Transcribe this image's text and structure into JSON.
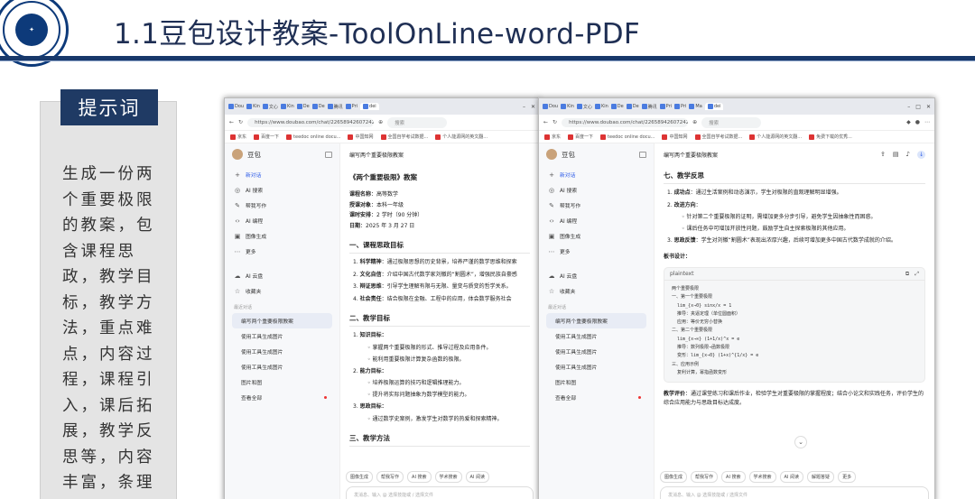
{
  "slide": {
    "title": "1.1豆包设计教案-ToolOnLine-word-PDF",
    "colors": {
      "navy": "#17386a",
      "badge": "#1f3a64",
      "panel": "#e4e4e4",
      "accent": "#2c5be8"
    },
    "logo_icon": "university-seal-icon"
  },
  "prompt": {
    "badge": "提示词",
    "text": "生成一份两个重要极限的教案，包含课程思政，教学目标，教学方法，重点难点，内容过程，课程引入，课后拓展，教学反思等，内容丰富，条理清晰。"
  },
  "browser": {
    "tabs": [
      "Dou",
      "Kin",
      "文心",
      "Kin",
      "De",
      "De",
      "腾讯",
      "Pri",
      "Pri",
      "Ma",
      "dei"
    ],
    "url": "https://www.doubao.com/chat/2265894260724226",
    "search_placeholder": "搜索",
    "bookmarks": [
      "京东",
      "百度一下",
      "teedoc online docu...",
      "中国知网",
      "全国自学考试数据...",
      "个人能源网的英文翻...",
      "免费下载的优秀..."
    ]
  },
  "app": {
    "name": "豆包",
    "nav": [
      {
        "label": "新对话",
        "icon": "+"
      },
      {
        "label": "AI 搜索",
        "icon": "◎"
      },
      {
        "label": "帮我写作",
        "icon": "✎"
      },
      {
        "label": "AI 编程",
        "icon": "‹›"
      },
      {
        "label": "图像生成",
        "icon": "▣"
      },
      {
        "label": "更多",
        "icon": "⋯"
      }
    ],
    "nav2": [
      {
        "label": "AI 云盘",
        "icon": "☁"
      },
      {
        "label": "收藏夹",
        "icon": "☆"
      }
    ],
    "history_header": "最近对话",
    "history": [
      "编写两个重要极限教案",
      "使用工具生成图片",
      "使用工具生成图片",
      "使用工具生成图片",
      "图片和图",
      "查看全部"
    ],
    "chat_title": "编写两个重要极限教案",
    "chips": [
      "图像生成",
      "帮我写作",
      "AI 搜索",
      "学术搜索",
      "AI 阅读"
    ],
    "chips2": [
      "图像生成",
      "帮我写作",
      "AI 搜索",
      "学术搜索",
      "AI 阅读",
      "解题答疑",
      "更多"
    ],
    "input_placeholder": "发消息、输入 @ 选择技能或 / 选择文件"
  },
  "doc1": {
    "title": "《两个重要极限》教案",
    "info": [
      {
        "k": "课程名称",
        "v": "高等数学"
      },
      {
        "k": "授课对象",
        "v": "本科一年级"
      },
      {
        "k": "课时安排",
        "v": "2 学时（90 分钟）"
      },
      {
        "k": "日期",
        "v": "2025 年 3 月 27 日"
      }
    ],
    "sec1": "一、课程思政目标",
    "goals": [
      {
        "k": "科学精神",
        "v": "通过极限思想的历史背景，培养严谨的数学思维和探索"
      },
      {
        "k": "文化自信",
        "v": "介绍中国古代数学家刘徽的“割圆术”，增强民族自豪感"
      },
      {
        "k": "辩证思维",
        "v": "引导学生理解有限与无限、量变与质变的哲学关系。"
      },
      {
        "k": "社会责任",
        "v": "结合极限在金融、工程中的应用，体会数学服务社会"
      }
    ],
    "sec2": "二、教学目标",
    "t1": "知识目标：",
    "t1_items": [
      "掌握两个重要极限的形式、推导过程及应用条件。",
      "能利用重要极限计算复杂函数的极限。"
    ],
    "t2": "能力目标：",
    "t2_items": [
      "培养极限运算的技巧和逻辑推理能力。",
      "提升将实际问题抽象为数学模型的能力。"
    ],
    "t3": "思政目标：",
    "t3_items": [
      "通过数学史案例，激发学生对数学的热爱和探索精神。"
    ],
    "sec3": "三、教学方法"
  },
  "doc2": {
    "sec": "七、教学反思",
    "items": [
      {
        "k": "成功点",
        "v": "通过生活案例和动态演示，学生对极限的直观理解明显增强。"
      },
      {
        "k": "改进方向",
        "v": ""
      },
      {
        "k": "思政反馈",
        "v": "学生对刘徽“割圆术”表现出浓厚兴趣，后续可增加更多中国古代数学成就的介绍。"
      }
    ],
    "improve": [
      "针对第二个重要极限的证明，需增加更多分步引导，避免学生因抽象性而困惑。",
      "课后任务中可增加开放性问题，鼓励学生自主探索极限的其他应用。"
    ],
    "board_title": "板书设计：",
    "code_lang": "plaintext",
    "code_lines": [
      "两个重要极限",
      "一、第一个重要极限",
      "  lim_{x→0} sinx/x = 1",
      "  推导：夹逼定理（单位圆面积）",
      "  应用：等价无穷小替换",
      "二、第二个重要极限",
      "  lim_{x→∞} (1+1/x)^x = e",
      "  推导：数列极限→函数极限",
      "  变形：lim_{x→0} (1+x)^{1/x} = e",
      "三、应用示例",
      "  复利计算，幂指函数变形"
    ],
    "eval_k": "教学评价",
    "eval_v": "通过课堂练习和课后作业，检验学生对重要极限的掌握程度；结合小论文和实践任务，评价学生的综合应用能力与思政目标达成度。"
  }
}
